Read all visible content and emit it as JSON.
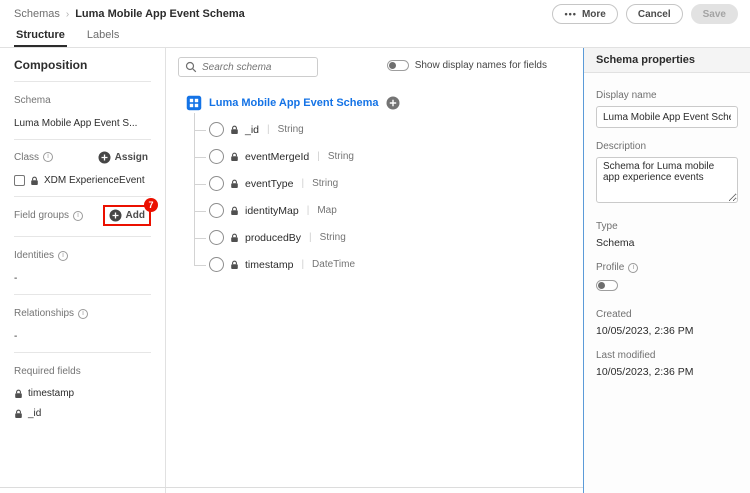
{
  "colors": {
    "accent": "#1473e6",
    "annotation": "#eb1000"
  },
  "header": {
    "breadcrumb": {
      "root": "Schemas",
      "separator": "›",
      "current": "Luma Mobile App Event Schema"
    },
    "buttons": {
      "more_dots": "•••",
      "more": "More",
      "cancel": "Cancel",
      "save": "Save"
    }
  },
  "tabs": [
    {
      "label": "Structure"
    },
    {
      "label": "Labels"
    }
  ],
  "composition": {
    "title": "Composition",
    "schema": {
      "label": "Schema",
      "value": "Luma Mobile App Event S..."
    },
    "class": {
      "label": "Class",
      "assign_button": "Assign",
      "item": "XDM ExperienceEvent"
    },
    "field_groups": {
      "label": "Field groups",
      "add_button": "Add",
      "annotation_badge": "7"
    },
    "identities": {
      "label": "Identities",
      "value": "-"
    },
    "relationships": {
      "label": "Relationships",
      "value": "-"
    },
    "required_fields": {
      "label": "Required fields",
      "items": [
        "timestamp",
        "_id"
      ]
    }
  },
  "canvas": {
    "search_placeholder": "Search schema",
    "display_names_toggle": "Show display names for fields",
    "root": "Luma Mobile App Event Schema",
    "field_separator": "|",
    "fields": [
      {
        "name": "_id",
        "type": "String"
      },
      {
        "name": "eventMergeId",
        "type": "String"
      },
      {
        "name": "eventType",
        "type": "String"
      },
      {
        "name": "identityMap",
        "type": "Map"
      },
      {
        "name": "producedBy",
        "type": "String"
      },
      {
        "name": "timestamp",
        "type": "DateTime"
      }
    ]
  },
  "properties": {
    "title": "Schema properties",
    "display_name": {
      "label": "Display name",
      "value": "Luma Mobile App Event Schema"
    },
    "description": {
      "label": "Description",
      "value": "Schema for Luma mobile app experience events"
    },
    "type": {
      "label": "Type",
      "value": "Schema"
    },
    "profile": {
      "label": "Profile"
    },
    "created": {
      "label": "Created",
      "value": "10/05/2023, 2:36 PM"
    },
    "last_modified": {
      "label": "Last modified",
      "value": "10/05/2023, 2:36 PM"
    }
  }
}
